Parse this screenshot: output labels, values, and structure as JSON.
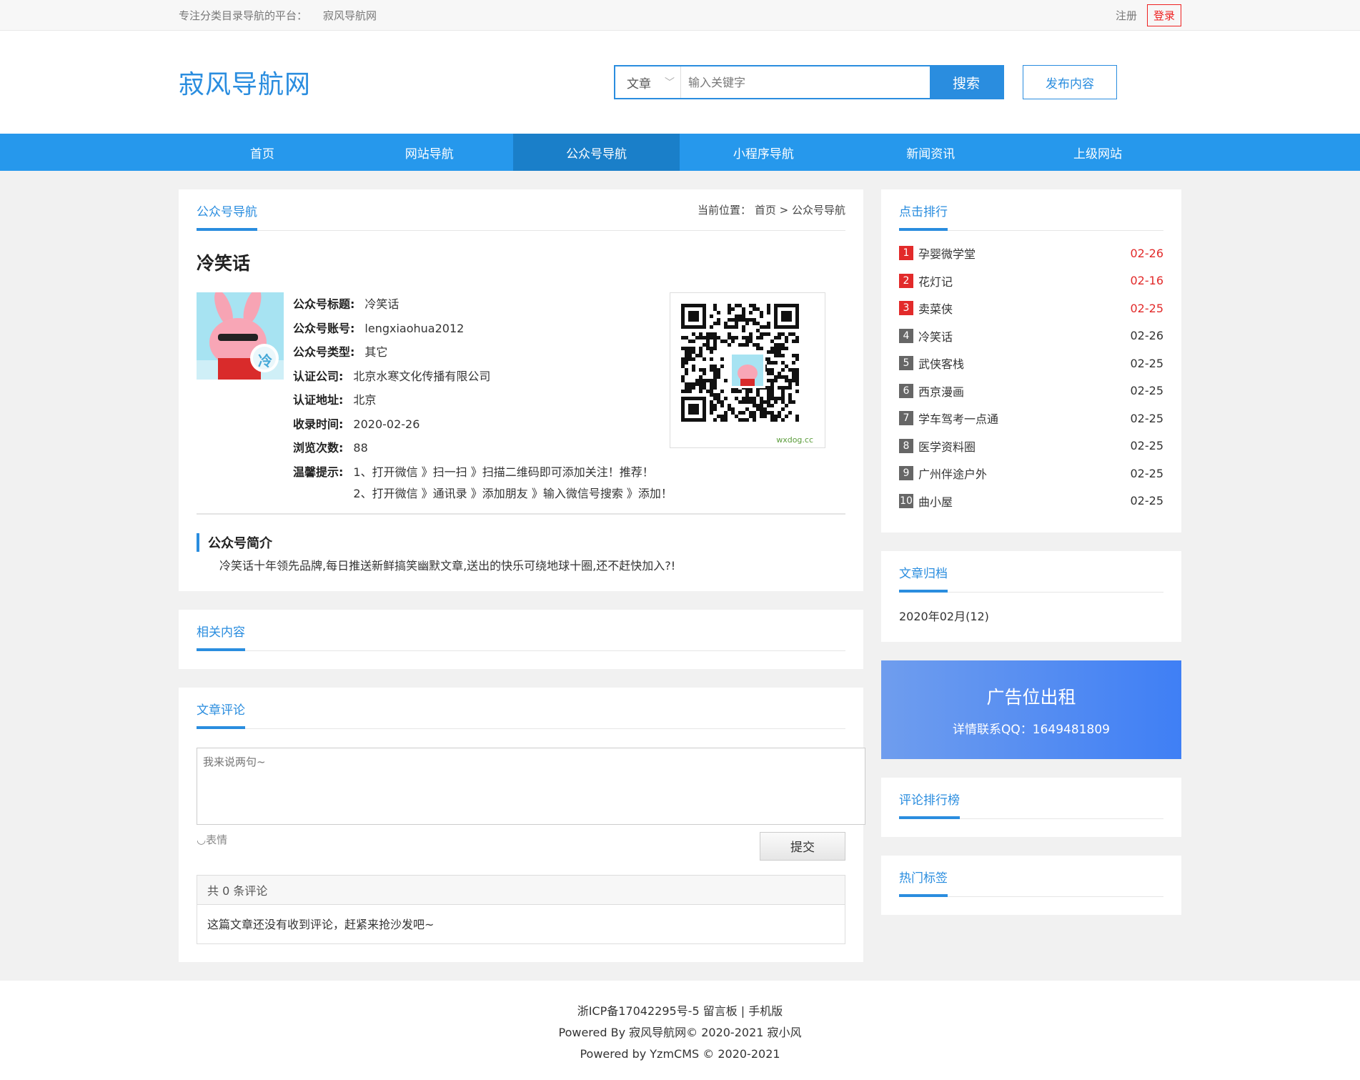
{
  "topbar": {
    "slogan": "专注分类目录导航的平台：",
    "site": "寂风导航网",
    "register": "注册",
    "login": "登录"
  },
  "header": {
    "logo": "寂风导航网",
    "category": "文章",
    "search_placeholder": "输入关键字",
    "search_btn": "搜索",
    "publish": "发布内容"
  },
  "nav": [
    "首页",
    "网站导航",
    "公众号导航",
    "小程序导航",
    "新闻资讯",
    "上级网站"
  ],
  "detail": {
    "tab": "公众号导航",
    "crumb_label": "当前位置：",
    "crumb_home": "首页",
    "crumb_sep": ">",
    "crumb_current": "公众号导航",
    "title": "冷笑话",
    "fields": [
      {
        "k": "公众号标题:",
        "v": "冷笑话"
      },
      {
        "k": "公众号账号:",
        "v": "lengxiaohua2012"
      },
      {
        "k": "公众号类型:",
        "v": "其它"
      },
      {
        "k": "认证公司:",
        "v": "北京水寒文化传播有限公司"
      },
      {
        "k": "认证地址:",
        "v": "北京"
      },
      {
        "k": "收录时间:",
        "v": "2020-02-26"
      },
      {
        "k": "浏览次数:",
        "v": "88"
      }
    ],
    "tip_label": "温馨提示:",
    "tip1": "1、打开微信 》扫一扫 》扫描二维码即可添加关注！推荐！",
    "tip2": "2、打开微信 》通讯录 》添加朋友 》输入微信号搜索 》添加！",
    "qr_caption": "wxdog.cc",
    "avatar_char": "冷",
    "intro_title": "公众号简介",
    "intro_body": "冷笑话十年领先品牌,每日推送新鲜搞笑幽默文章,送出的快乐可绕地球十圈,还不赶快加入?!"
  },
  "related": {
    "tab": "相关内容"
  },
  "comments": {
    "tab": "文章评论",
    "placeholder": "我来说两句~",
    "emoji": "表情",
    "submit": "提交",
    "count": "共 0 条评论",
    "empty": "这篇文章还没有收到评论，赶紧来抢沙发吧~"
  },
  "sidebar": {
    "rank_title": "点击排行",
    "rank": [
      {
        "n": "1",
        "name": "孕婴微学堂",
        "date": "02-26"
      },
      {
        "n": "2",
        "name": "花灯记",
        "date": "02-16"
      },
      {
        "n": "3",
        "name": "卖菜侠",
        "date": "02-25"
      },
      {
        "n": "4",
        "name": "冷笑话",
        "date": "02-26"
      },
      {
        "n": "5",
        "name": "武侠客栈",
        "date": "02-25"
      },
      {
        "n": "6",
        "name": "西京漫画",
        "date": "02-25"
      },
      {
        "n": "7",
        "name": "学车驾考一点通",
        "date": "02-25"
      },
      {
        "n": "8",
        "name": "医学资料圈",
        "date": "02-25"
      },
      {
        "n": "9",
        "name": "广州伴途户外",
        "date": "02-25"
      },
      {
        "n": "10",
        "name": "曲小屋",
        "date": "02-25"
      }
    ],
    "archive_title": "文章归档",
    "archive_item": "2020年02月(12)",
    "ad_title": "广告位出租",
    "ad_sub": "详情联系QQ：1649481809",
    "comment_rank_title": "评论排行榜",
    "tags_title": "热门标签"
  },
  "footer": {
    "line1": "浙ICP备17042295号-5 留言板 | 手机版",
    "line2": "Powered By 寂风导航网© 2020-2021 寂小风",
    "line3": "Powered by YzmCMS © 2020-2021"
  },
  "colors": {
    "brand": "#2a8ddf",
    "nav": "#2698ec",
    "hot": "#e22a2a"
  }
}
